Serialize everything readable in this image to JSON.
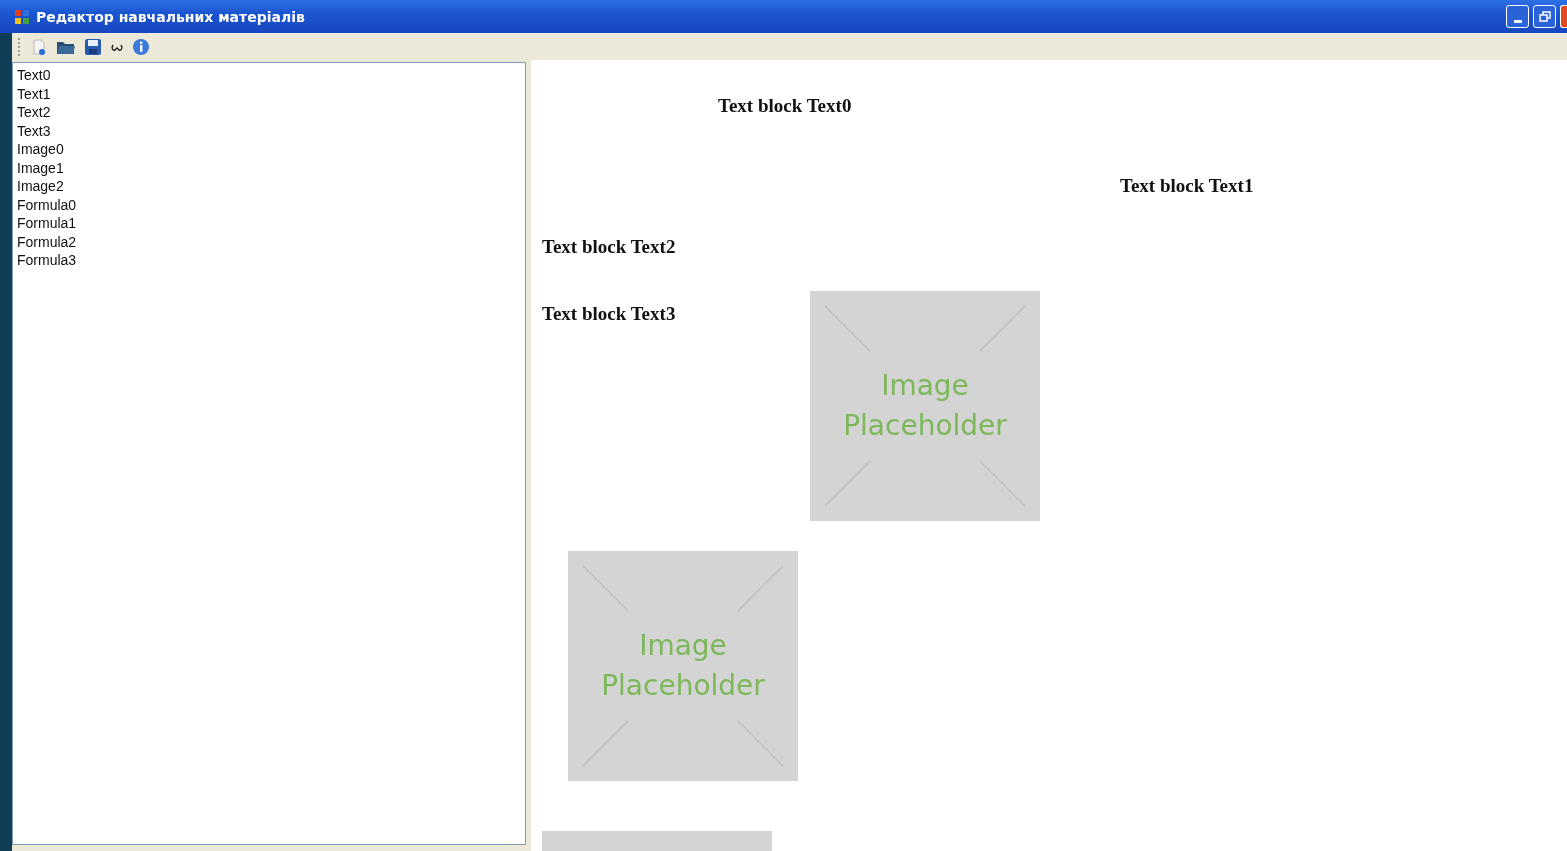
{
  "window": {
    "title": "Редактор навчальних матеріалів"
  },
  "outline": {
    "items": [
      {
        "label": "Text0",
        "selected": false
      },
      {
        "label": "Text1",
        "selected": false
      },
      {
        "label": "Text2",
        "selected": false
      },
      {
        "label": "Text3",
        "selected": false
      },
      {
        "label": "Image0",
        "selected": false
      },
      {
        "label": "Image1",
        "selected": false
      },
      {
        "label": "Image2",
        "selected": false
      },
      {
        "label": "Formula0",
        "selected": false
      },
      {
        "label": "Formula1",
        "selected": false
      },
      {
        "label": "Formula2",
        "selected": false
      },
      {
        "label": "Formula3",
        "selected": false
      }
    ]
  },
  "canvas": {
    "blocks": [
      {
        "kind": "text",
        "text": "Text block Text0"
      },
      {
        "kind": "text",
        "text": "Text block Text1"
      },
      {
        "kind": "text",
        "text": "Text block Text2"
      },
      {
        "kind": "text",
        "text": "Text block Text3"
      },
      {
        "kind": "image",
        "caption": [
          "Image",
          "Placeholder"
        ]
      },
      {
        "kind": "image",
        "caption": [
          "Image",
          "Placeholder"
        ]
      },
      {
        "kind": "image"
      }
    ]
  }
}
